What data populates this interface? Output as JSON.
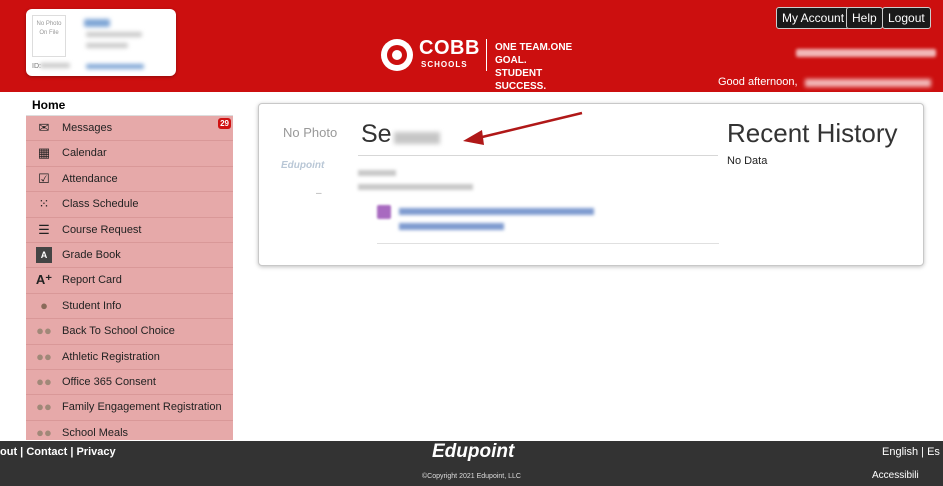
{
  "header": {
    "id_card": {
      "photo_text": "No Photo On File",
      "id_label": "ID:"
    },
    "logo": {
      "cobb": "COBB",
      "schools": "SCHOOLS",
      "tagline_1": "ONE TEAM.ONE GOAL.",
      "tagline_2": "STUDENT SUCCESS."
    },
    "buttons": {
      "my_account": "My Account",
      "help": "Help",
      "logout": "Logout"
    },
    "greeting": "Good afternoon,",
    "brand_color": "#cc0f0f"
  },
  "sidebar": {
    "home": "Home",
    "items": [
      {
        "label": "Messages",
        "icon": "envelope-icon",
        "badge": "29"
      },
      {
        "label": "Calendar",
        "icon": "calendar-icon"
      },
      {
        "label": "Attendance",
        "icon": "checkbox-icon"
      },
      {
        "label": "Class Schedule",
        "icon": "schedule-icon"
      },
      {
        "label": "Course Request",
        "icon": "list-icon"
      },
      {
        "label": "Grade Book",
        "icon": "gradebook-icon"
      },
      {
        "label": "Report Card",
        "icon": "report-card-icon"
      },
      {
        "label": "Student Info",
        "icon": "user-icon"
      },
      {
        "label": "Back To School Choice",
        "icon": "people-icon"
      },
      {
        "label": "Athletic Registration",
        "icon": "people-icon"
      },
      {
        "label": "Office 365 Consent",
        "icon": "people-icon"
      },
      {
        "label": "Family Engagement Registration",
        "icon": "people-icon"
      },
      {
        "label": "School Meals",
        "icon": "people-icon"
      }
    ]
  },
  "main": {
    "no_photo": "No Photo",
    "edupoint": "Edupoint",
    "dash": "–",
    "student_name": "Se",
    "recent_history_title": "Recent History",
    "recent_history_empty": "No Data"
  },
  "footer": {
    "link_about": "out",
    "link_contact": "Contact",
    "link_privacy": "Privacy",
    "brand": "Edupoint",
    "copyright": "©Copyright 2021 Edupoint, LLC",
    "language": "English",
    "language_partial": "Es",
    "accessibility": "Accessibili"
  }
}
